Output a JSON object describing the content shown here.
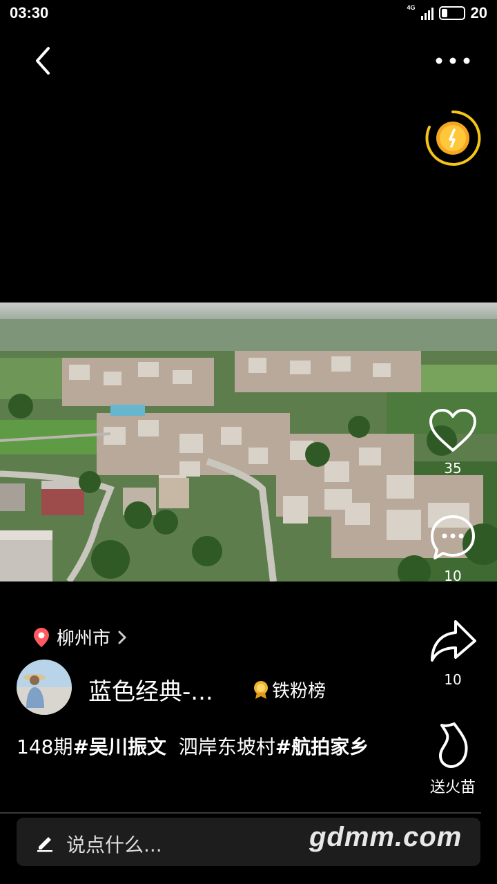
{
  "status_bar": {
    "time": "03:30",
    "network": "4G",
    "battery": "20"
  },
  "location": {
    "name": "柳州市"
  },
  "actions": {
    "like_count": "35",
    "comment_count": "10",
    "share_count": "10",
    "gift_label": "送火苗"
  },
  "author": {
    "name": "蓝色经典-...",
    "badge": "铁粉榜"
  },
  "caption": {
    "part1": "148期",
    "tag1": "#吴川振文",
    "part2": "  泗岸东坡村",
    "tag2": "#航拍家乡"
  },
  "comment_input": {
    "placeholder": "说点什么..."
  },
  "watermark": "gdmm.com",
  "colors": {
    "background": "#000000",
    "coin_ring": "#f5c518",
    "location_pin": "#ff5a5f",
    "badge": "#f0b429"
  },
  "icons": [
    "back-arrow-icon",
    "more-dots-icon",
    "coin-icon",
    "heart-icon",
    "comment-icon",
    "share-icon",
    "flame-icon",
    "location-pin-icon",
    "pencil-icon",
    "badge-icon"
  ]
}
